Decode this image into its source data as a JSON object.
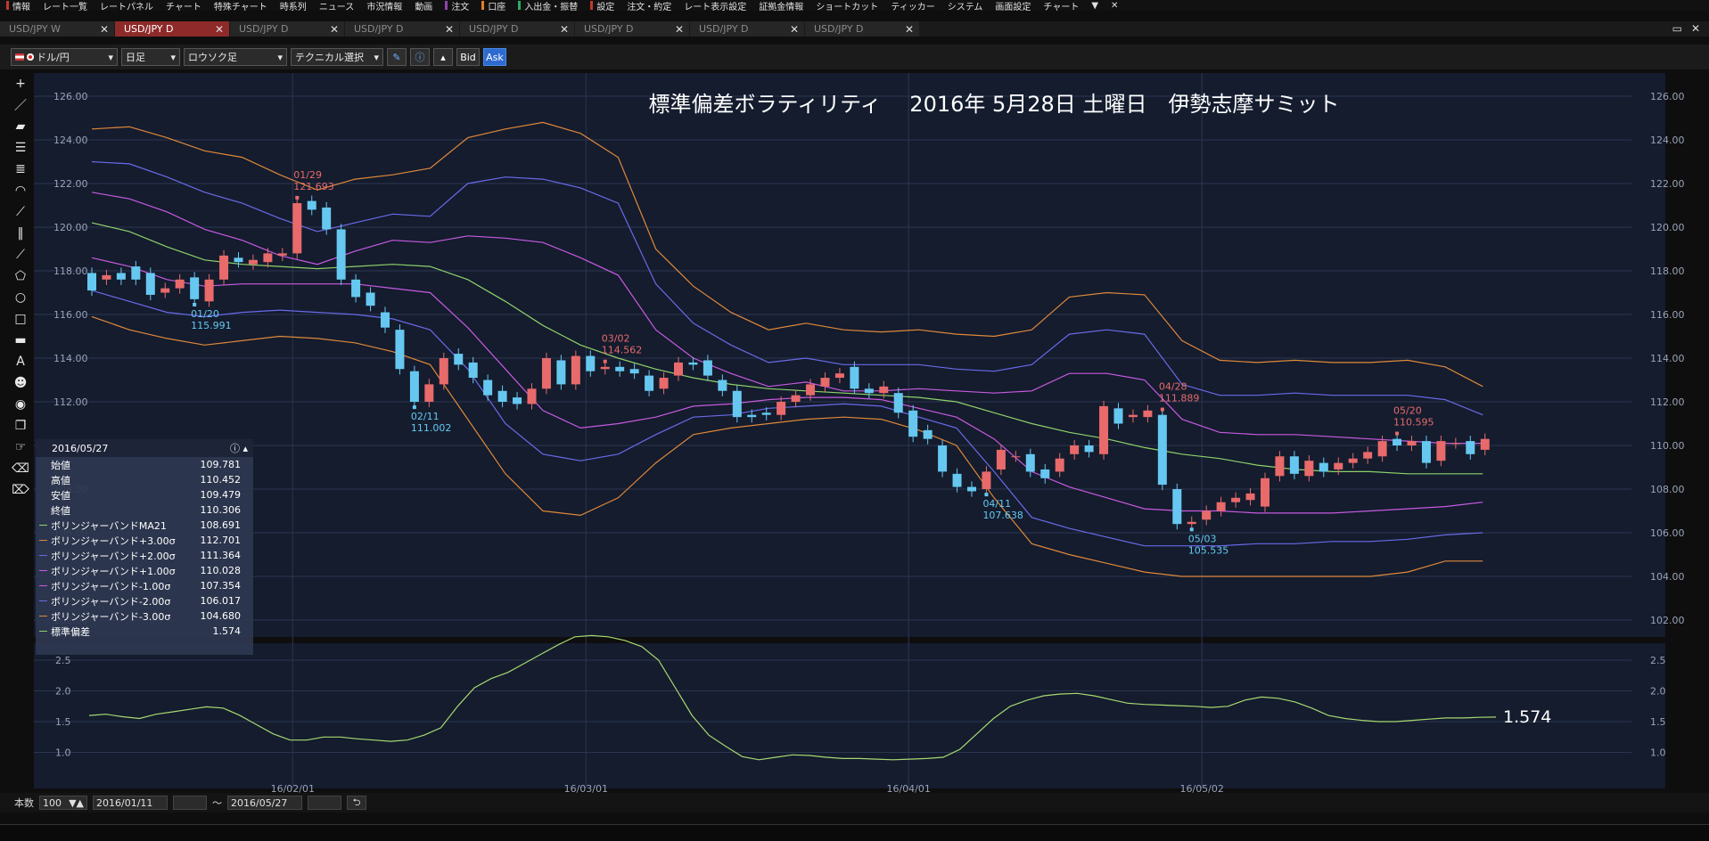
{
  "menu": [
    {
      "label": "情報",
      "accent": "#c0392b"
    },
    {
      "label": "レート一覧",
      "accent": ""
    },
    {
      "label": "レートパネル",
      "accent": ""
    },
    {
      "label": "チャート",
      "accent": ""
    },
    {
      "label": "特殊チャート",
      "accent": ""
    },
    {
      "label": "時系列",
      "accent": ""
    },
    {
      "label": "ニュース",
      "accent": ""
    },
    {
      "label": "市況情報",
      "accent": ""
    },
    {
      "label": "動画",
      "accent": ""
    },
    {
      "label": "注文",
      "accent": "#8e44ad"
    },
    {
      "label": "口座",
      "accent": "#e67e22"
    },
    {
      "label": "入出金・振替",
      "accent": "#27ae60"
    },
    {
      "label": "設定",
      "accent": "#c0392b"
    },
    {
      "label": "注文・約定",
      "accent": ""
    },
    {
      "label": "レート表示設定",
      "accent": ""
    },
    {
      "label": "証拠金情報",
      "accent": ""
    },
    {
      "label": "ショートカット",
      "accent": ""
    },
    {
      "label": "ティッカー",
      "accent": ""
    },
    {
      "label": "システム",
      "accent": ""
    },
    {
      "label": "画面設定",
      "accent": ""
    },
    {
      "label": "チャート",
      "accent": ""
    },
    {
      "label": "▼",
      "accent": ""
    },
    {
      "label": "✕",
      "accent": ""
    }
  ],
  "tabs": [
    {
      "label": "USD/JPY W",
      "active": false
    },
    {
      "label": "USD/JPY D",
      "active": true
    },
    {
      "label": "USD/JPY D",
      "active": false
    },
    {
      "label": "USD/JPY D",
      "active": false
    },
    {
      "label": "USD/JPY D",
      "active": false
    },
    {
      "label": "USD/JPY D",
      "active": false
    },
    {
      "label": "USD/JPY D",
      "active": false
    },
    {
      "label": "USD/JPY D",
      "active": false
    }
  ],
  "toolbar": {
    "currency": "ドル/円",
    "period": "日足",
    "chart_style": "ロウソク足",
    "technical": "テクニカル選択",
    "bid": "Bid",
    "ask": "Ask"
  },
  "bottom": {
    "count_label": "本数",
    "count_value": "100",
    "date_from": "2016/01/11",
    "tilde": "〜",
    "date_to": "2016/05/27"
  },
  "info": {
    "date": "2016/05/27",
    "rows": [
      {
        "label": "始値",
        "value": "109.781",
        "color": ""
      },
      {
        "label": "高値",
        "value": "110.452",
        "color": ""
      },
      {
        "label": "安値",
        "value": "109.479",
        "color": ""
      },
      {
        "label": "終値",
        "value": "110.306",
        "color": ""
      },
      {
        "label": "ボリンジャーバンドMA21",
        "value": "108.691",
        "color": "#8fd16a"
      },
      {
        "label": "ボリンジャーバンド+3.00σ",
        "value": "112.701",
        "color": "#e0883a"
      },
      {
        "label": "ボリンジャーバンド+2.00σ",
        "value": "111.364",
        "color": "#6a6ae8"
      },
      {
        "label": "ボリンジャーバンド+1.00σ",
        "value": "110.028",
        "color": "#c85ae0"
      },
      {
        "label": "ボリンジャーバンド-1.00σ",
        "value": "107.354",
        "color": "#c85ae0"
      },
      {
        "label": "ボリンジャーバンド-2.00σ",
        "value": "106.017",
        "color": "#6a6ae8"
      },
      {
        "label": "ボリンジャーバンド-3.00σ",
        "value": "104.680",
        "color": "#e0883a"
      },
      {
        "label": "標準偏差",
        "value": "1.574",
        "color": "#8fd16a"
      }
    ]
  },
  "colors": {
    "bg": "#141c2e",
    "grid": "#2c3650",
    "up": "#e86a6a",
    "down": "#66c8f0",
    "ma": "#8fd16a",
    "sigma3": "#e0883a",
    "sigma2": "#6a6ae8",
    "sigma1": "#c85ae0",
    "stdev": "#a8d870",
    "axis_text": "#9aa3b8"
  },
  "chart_data": {
    "type": "candlestick",
    "title": "標準偏差ボラティリティ　 2016年 5月28日 土曜日　伊勢志摩サミット",
    "ylim": [
      101.5,
      126.5
    ],
    "yticks": [
      102,
      104,
      106,
      108,
      110,
      112,
      114,
      116,
      118,
      120,
      122,
      124,
      126
    ],
    "ytick_labels": [
      "102.00",
      "104.00",
      "106.00",
      "108.00",
      "110.00",
      "112.00",
      "114.00",
      "116.00",
      "118.00",
      "120.00",
      "122.00",
      "124.00",
      "126.00"
    ],
    "x_labels": [
      {
        "label": "16/02/01",
        "index": 14
      },
      {
        "label": "16/03/01",
        "index": 34
      },
      {
        "label": "16/04/01",
        "index": 56
      },
      {
        "label": "16/05/02",
        "index": 76
      }
    ],
    "candles": [
      [
        117.9,
        117.1
      ],
      [
        117.6,
        117.8
      ],
      [
        117.9,
        117.6
      ],
      [
        118.2,
        117.6
      ],
      [
        117.9,
        116.9
      ],
      [
        117.0,
        117.2
      ],
      [
        117.2,
        117.6
      ],
      [
        117.7,
        116.7
      ],
      [
        116.6,
        117.6
      ],
      [
        117.6,
        118.7
      ],
      [
        118.6,
        118.4
      ],
      [
        118.3,
        118.5
      ],
      [
        118.4,
        118.8
      ],
      [
        118.7,
        118.8
      ],
      [
        118.8,
        121.1
      ],
      [
        121.2,
        120.8
      ],
      [
        120.9,
        119.9
      ],
      [
        119.9,
        117.6
      ],
      [
        117.6,
        116.8
      ],
      [
        117.0,
        116.4
      ],
      [
        116.1,
        115.4
      ],
      [
        115.3,
        113.5
      ],
      [
        113.4,
        112.0
      ],
      [
        112.0,
        112.8
      ],
      [
        112.8,
        114.0
      ],
      [
        114.2,
        113.7
      ],
      [
        113.8,
        113.1
      ],
      [
        113.0,
        112.3
      ],
      [
        112.5,
        112.0
      ],
      [
        112.2,
        111.9
      ],
      [
        111.9,
        112.6
      ],
      [
        112.6,
        114.0
      ],
      [
        113.9,
        112.8
      ],
      [
        112.8,
        114.1
      ],
      [
        114.1,
        113.4
      ],
      [
        113.5,
        113.6
      ],
      [
        113.6,
        113.4
      ],
      [
        113.5,
        113.3
      ],
      [
        113.2,
        112.5
      ],
      [
        112.6,
        113.1
      ],
      [
        113.2,
        113.8
      ],
      [
        113.8,
        113.7
      ],
      [
        113.9,
        113.2
      ],
      [
        113.0,
        112.5
      ],
      [
        112.5,
        111.3
      ],
      [
        111.4,
        111.3
      ],
      [
        111.5,
        111.4
      ],
      [
        111.4,
        112.0
      ],
      [
        112.0,
        112.3
      ],
      [
        112.3,
        112.8
      ],
      [
        112.7,
        113.1
      ],
      [
        113.1,
        113.3
      ],
      [
        113.6,
        112.6
      ],
      [
        112.6,
        112.4
      ],
      [
        112.4,
        112.7
      ],
      [
        112.4,
        111.5
      ],
      [
        111.6,
        110.4
      ],
      [
        110.7,
        110.3
      ],
      [
        110.0,
        108.8
      ],
      [
        108.7,
        108.1
      ],
      [
        108.1,
        107.9
      ],
      [
        108.0,
        108.8
      ],
      [
        108.9,
        109.8
      ],
      [
        109.5,
        109.5
      ],
      [
        109.6,
        108.8
      ],
      [
        108.9,
        108.5
      ],
      [
        108.8,
        109.4
      ],
      [
        109.6,
        110.0
      ],
      [
        110.0,
        109.7
      ],
      [
        109.6,
        111.8
      ],
      [
        111.7,
        111.0
      ],
      [
        111.3,
        111.4
      ],
      [
        111.3,
        111.6
      ],
      [
        111.4,
        108.2
      ],
      [
        108.0,
        106.4
      ],
      [
        106.4,
        106.5
      ],
      [
        106.6,
        107.0
      ],
      [
        107.0,
        107.4
      ],
      [
        107.4,
        107.6
      ],
      [
        107.5,
        107.8
      ],
      [
        107.2,
        108.5
      ],
      [
        108.6,
        109.5
      ],
      [
        109.5,
        108.7
      ],
      [
        108.6,
        109.3
      ],
      [
        109.2,
        108.8
      ],
      [
        108.9,
        109.2
      ],
      [
        109.2,
        109.4
      ],
      [
        109.4,
        109.7
      ],
      [
        109.5,
        110.2
      ],
      [
        110.3,
        110.0
      ],
      [
        110.0,
        110.2
      ],
      [
        110.2,
        109.2
      ],
      [
        109.3,
        110.2
      ],
      [
        110.1,
        110.1
      ],
      [
        110.2,
        109.6
      ],
      [
        109.8,
        110.3
      ]
    ],
    "sigma_p3": [
      124.5,
      124.6,
      124.1,
      123.5,
      123.2,
      122.4,
      121.7,
      122.2,
      122.4,
      122.7,
      124.1,
      124.5,
      124.8,
      124.3,
      123.2,
      119.0,
      117.3,
      116.1,
      115.3,
      115.6,
      115.3,
      115.2,
      115.3,
      115.1,
      115.0,
      115.3,
      116.8,
      117.0,
      116.9,
      114.8,
      113.9,
      113.8,
      113.9,
      113.8,
      113.8,
      113.9,
      113.6,
      112.7
    ],
    "sigma_p2": [
      123.0,
      122.9,
      122.3,
      121.6,
      121.1,
      120.4,
      119.8,
      120.2,
      120.6,
      120.5,
      122.0,
      122.3,
      122.2,
      121.8,
      121.1,
      117.4,
      115.6,
      114.6,
      113.8,
      114.0,
      113.7,
      113.7,
      113.7,
      113.5,
      113.4,
      113.7,
      115.1,
      115.3,
      115.1,
      112.8,
      112.3,
      112.3,
      112.4,
      112.3,
      112.3,
      112.3,
      112.1,
      111.4
    ],
    "sigma_p1": [
      121.6,
      121.3,
      120.7,
      119.9,
      119.4,
      118.7,
      118.3,
      118.9,
      119.4,
      119.3,
      119.6,
      119.5,
      119.3,
      118.6,
      117.8,
      115.3,
      114.0,
      113.3,
      112.7,
      112.9,
      112.5,
      112.5,
      112.6,
      112.5,
      112.4,
      112.5,
      113.3,
      113.3,
      113.0,
      111.2,
      110.6,
      110.5,
      110.5,
      110.4,
      110.3,
      110.2,
      110.1,
      110.1
    ],
    "ma": [
      120.2,
      119.8,
      119.1,
      118.5,
      118.3,
      118.2,
      118.1,
      118.2,
      118.3,
      118.2,
      117.6,
      116.6,
      115.5,
      114.6,
      114.0,
      113.5,
      113.1,
      112.8,
      112.6,
      112.5,
      112.4,
      112.3,
      112.2,
      112.0,
      111.5,
      111.0,
      110.6,
      110.3,
      109.9,
      109.6,
      109.4,
      109.1,
      108.9,
      108.8,
      108.8,
      108.7,
      108.7,
      108.7
    ],
    "sigma_m1": [
      118.6,
      118.2,
      117.6,
      117.3,
      117.4,
      117.4,
      117.4,
      117.4,
      117.2,
      117.0,
      115.4,
      113.5,
      111.6,
      110.8,
      111.0,
      111.3,
      111.8,
      111.9,
      112.1,
      112.2,
      112.2,
      112.1,
      111.7,
      111.3,
      110.3,
      108.8,
      108.1,
      107.6,
      107.1,
      107.0,
      107.0,
      106.9,
      106.9,
      106.9,
      107.0,
      107.1,
      107.2,
      107.4
    ],
    "sigma_m2": [
      117.1,
      116.6,
      116.1,
      115.9,
      116.1,
      116.2,
      116.1,
      116.0,
      115.8,
      115.3,
      113.5,
      111.0,
      109.6,
      109.3,
      109.6,
      110.5,
      111.3,
      111.4,
      111.7,
      111.8,
      111.9,
      111.8,
      111.3,
      110.8,
      108.8,
      106.7,
      106.2,
      105.8,
      105.4,
      105.4,
      105.4,
      105.5,
      105.5,
      105.6,
      105.6,
      105.7,
      105.9,
      106.0
    ],
    "sigma_m3": [
      115.9,
      115.3,
      114.9,
      114.6,
      114.8,
      115.0,
      114.9,
      114.7,
      114.3,
      113.7,
      111.2,
      108.7,
      107.0,
      106.8,
      107.6,
      109.2,
      110.5,
      110.8,
      111.0,
      111.2,
      111.3,
      111.2,
      110.7,
      110.0,
      107.6,
      105.5,
      105.0,
      104.6,
      104.2,
      104.0,
      104.0,
      104.0,
      104.0,
      104.0,
      104.0,
      104.2,
      104.7,
      104.7
    ],
    "annotations": [
      {
        "label": "01/29",
        "value": "121.693",
        "index": 14,
        "kind": "high"
      },
      {
        "label": "01/20",
        "value": "115.991",
        "index": 7,
        "kind": "low"
      },
      {
        "label": "02/11",
        "value": "111.002",
        "index": 22,
        "kind": "low"
      },
      {
        "label": "03/02",
        "value": "114.562",
        "index": 35,
        "kind": "high"
      },
      {
        "label": "04/11",
        "value": "107.638",
        "index": 61,
        "kind": "low"
      },
      {
        "label": "04/28",
        "value": "111.889",
        "index": 73,
        "kind": "high"
      },
      {
        "label": "05/03",
        "value": "105.535",
        "index": 75,
        "kind": "low"
      },
      {
        "label": "05/20",
        "value": "110.595",
        "index": 89,
        "kind": "high"
      }
    ],
    "stdev": {
      "ylim": [
        0.7,
        3.0
      ],
      "yticks": [
        1.0,
        1.5,
        2.0,
        2.5
      ],
      "ytick_labels": [
        "1.0",
        "1.5",
        "2.0",
        "2.5"
      ],
      "values": [
        1.6,
        1.62,
        1.58,
        1.55,
        1.62,
        1.66,
        1.7,
        1.74,
        1.72,
        1.6,
        1.45,
        1.3,
        1.2,
        1.2,
        1.25,
        1.25,
        1.22,
        1.2,
        1.18,
        1.2,
        1.28,
        1.4,
        1.75,
        2.05,
        2.2,
        2.3,
        2.45,
        2.6,
        2.75,
        2.88,
        2.9,
        2.88,
        2.82,
        2.72,
        2.5,
        2.05,
        1.6,
        1.28,
        1.1,
        0.93,
        0.88,
        0.92,
        0.96,
        0.95,
        0.92,
        0.9,
        0.9,
        0.89,
        0.88,
        0.89,
        0.9,
        0.92,
        1.05,
        1.3,
        1.55,
        1.75,
        1.85,
        1.92,
        1.95,
        1.96,
        1.92,
        1.86,
        1.8,
        1.78,
        1.77,
        1.76,
        1.75,
        1.73,
        1.75,
        1.85,
        1.9,
        1.88,
        1.82,
        1.72,
        1.6,
        1.55,
        1.52,
        1.5,
        1.5,
        1.52,
        1.54,
        1.56,
        1.56,
        1.57,
        1.574
      ],
      "last_label": "1.574"
    }
  }
}
